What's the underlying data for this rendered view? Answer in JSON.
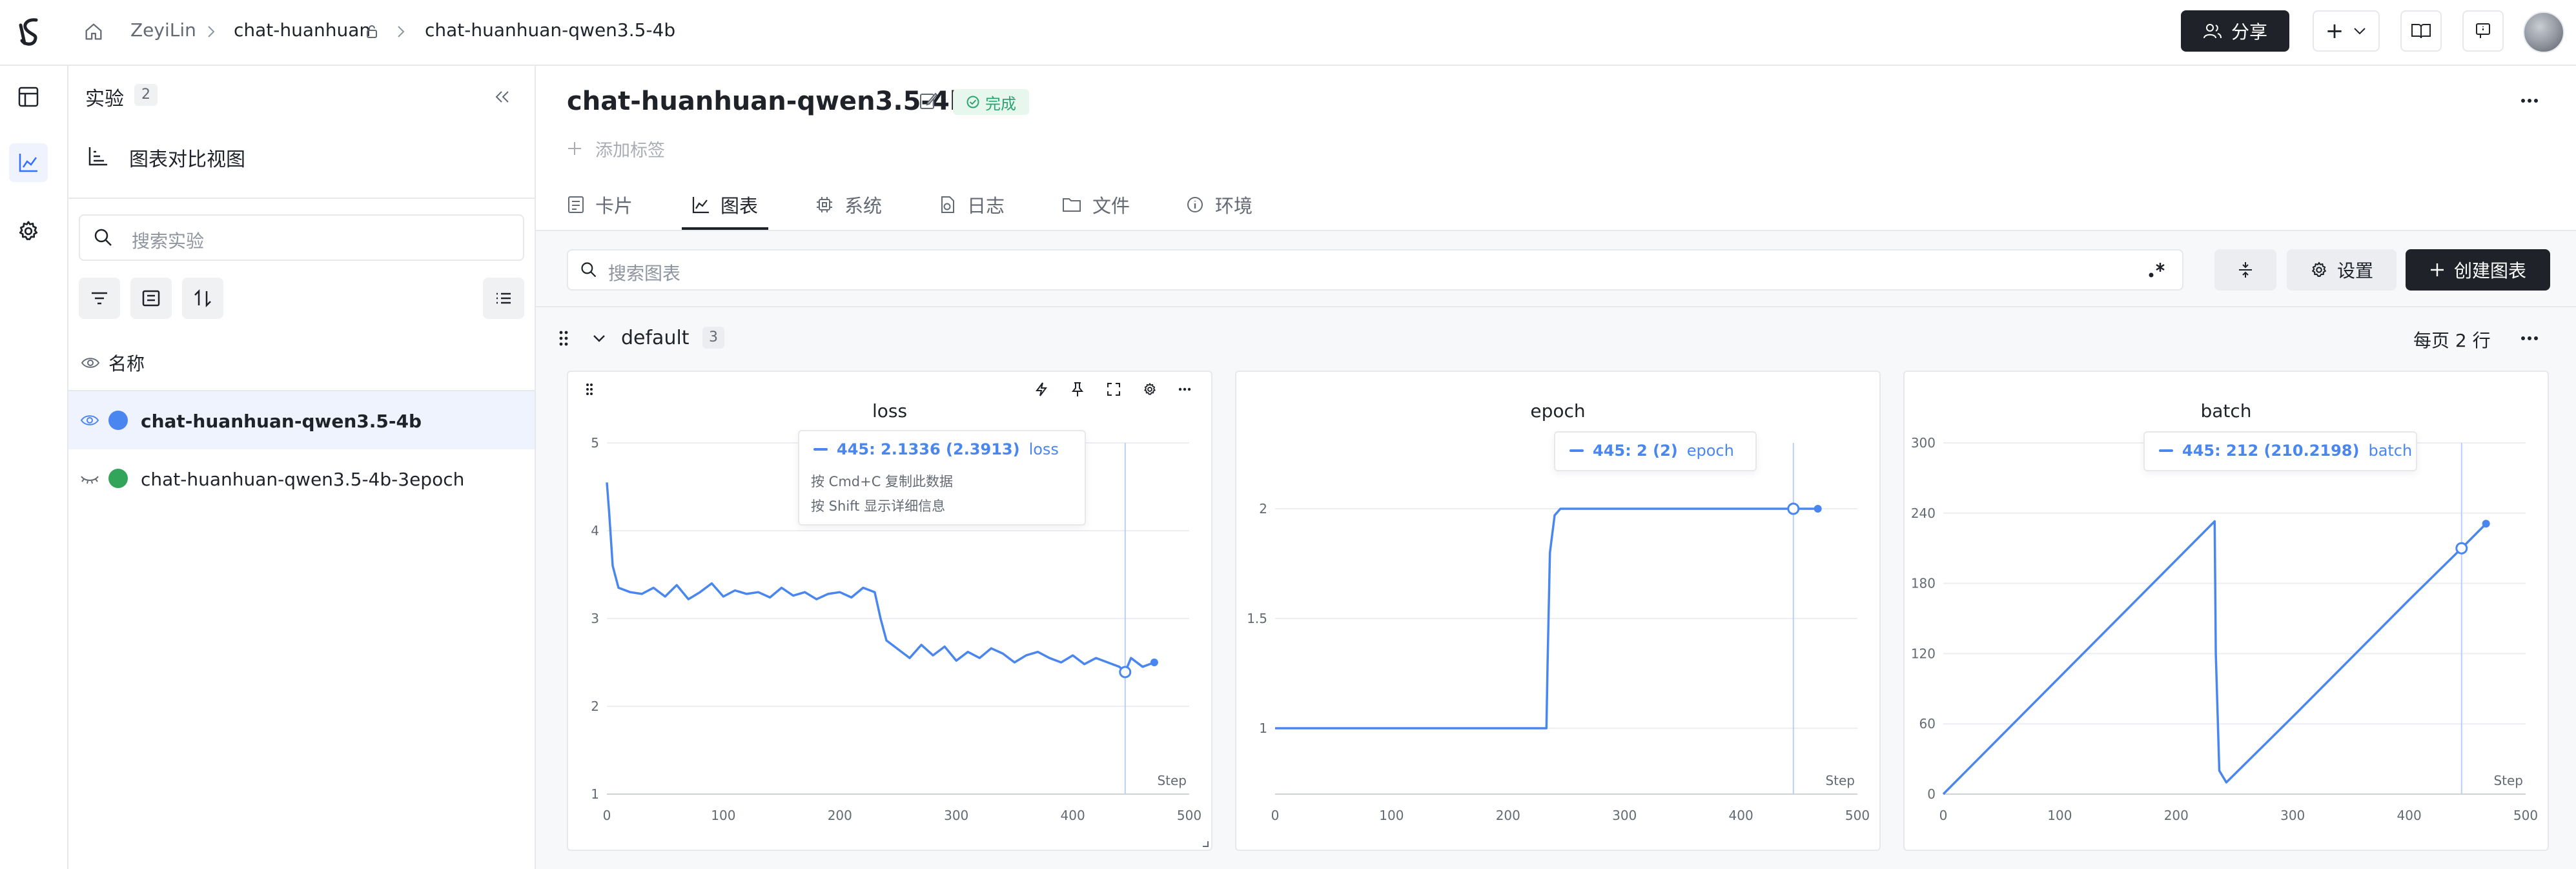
{
  "breadcrumb": {
    "user": "ZeyiLin",
    "project": "chat-huanhuan",
    "run": "chat-huanhuan-qwen3.5-4b"
  },
  "header": {
    "share_label": "分享",
    "add_label": "+"
  },
  "sidebar": {
    "title": "实验",
    "count": "2",
    "view_label": "图表对比视图",
    "search_placeholder": "搜索实验",
    "name_column": "名称",
    "experiments": [
      {
        "name": "chat-huanhuan-qwen3.5-4b",
        "color": "#4a86f0",
        "visible": true,
        "selected": true
      },
      {
        "name": "chat-huanhuan-qwen3.5-4b-3epoch",
        "color": "#33a55b",
        "visible": false,
        "selected": false
      }
    ]
  },
  "run": {
    "title": "chat-huanhuan-qwen3.5-4b",
    "status": "完成",
    "add_tag": "添加标签"
  },
  "tabs": [
    {
      "label": "卡片",
      "icon": "card-icon",
      "active": false
    },
    {
      "label": "图表",
      "icon": "chart-icon",
      "active": true
    },
    {
      "label": "系统",
      "icon": "cpu-icon",
      "active": false
    },
    {
      "label": "日志",
      "icon": "log-icon",
      "active": false
    },
    {
      "label": "文件",
      "icon": "folder-icon",
      "active": false
    },
    {
      "label": "环境",
      "icon": "info-icon",
      "active": false
    }
  ],
  "toolbar": {
    "search_placeholder": "搜索图表",
    "settings_label": "设置",
    "create_label": "创建图表"
  },
  "group": {
    "name": "default",
    "count": "3",
    "per_page": "每页 2 行"
  },
  "colors": {
    "accent": "#4a86f0",
    "status_green": "#2ba471",
    "dark_button": "#1f2329"
  },
  "charts": [
    {
      "tooltip": {
        "value": "445: 2.1336 (2.3913)",
        "metric": "loss",
        "hint1": "按 Cmd+C 复制此数据",
        "hint2": "按 Shift 显示详细信息"
      }
    },
    {
      "tooltip": {
        "value": "445: 2 (2)",
        "metric": "epoch"
      }
    },
    {
      "tooltip": {
        "value": "445: 212 (210.2198)",
        "metric": "batch"
      }
    }
  ],
  "chart_data": [
    {
      "type": "line",
      "title": "loss",
      "xlabel": "Step",
      "ylabel": "",
      "xlim": [
        0,
        500
      ],
      "ylim": [
        1,
        5
      ],
      "xticks": [
        0,
        100,
        200,
        300,
        400,
        500
      ],
      "yticks": [
        1,
        2,
        3,
        4,
        5
      ],
      "hover_x": 445,
      "hover_y": 2.39,
      "series": [
        {
          "color": "#4a86f0",
          "x": [
            0,
            2,
            5,
            10,
            20,
            30,
            40,
            50,
            60,
            70,
            80,
            90,
            100,
            110,
            120,
            130,
            140,
            150,
            160,
            170,
            180,
            190,
            200,
            210,
            220,
            230,
            235,
            240,
            250,
            260,
            270,
            280,
            290,
            300,
            310,
            320,
            330,
            340,
            350,
            360,
            370,
            380,
            390,
            400,
            410,
            420,
            430,
            440,
            445,
            450,
            460,
            470
          ],
          "y": [
            4.55,
            4.2,
            3.6,
            3.35,
            3.3,
            3.28,
            3.35,
            3.25,
            3.38,
            3.22,
            3.3,
            3.4,
            3.25,
            3.32,
            3.28,
            3.3,
            3.24,
            3.35,
            3.26,
            3.3,
            3.22,
            3.28,
            3.3,
            3.24,
            3.35,
            3.3,
            3.0,
            2.75,
            2.65,
            2.55,
            2.7,
            2.58,
            2.68,
            2.52,
            2.62,
            2.55,
            2.66,
            2.6,
            2.5,
            2.58,
            2.62,
            2.55,
            2.5,
            2.58,
            2.48,
            2.55,
            2.5,
            2.45,
            2.39,
            2.55,
            2.45,
            2.5
          ]
        }
      ]
    },
    {
      "type": "line",
      "title": "epoch",
      "xlabel": "Step",
      "ylabel": "",
      "xlim": [
        0,
        500
      ],
      "ylim": [
        0.7,
        2.3
      ],
      "xticks": [
        0,
        100,
        200,
        300,
        400,
        500
      ],
      "yticks": [
        1,
        1.5,
        2
      ],
      "hover_x": 445,
      "hover_y": 2,
      "series": [
        {
          "color": "#4a86f0",
          "x": [
            0,
            100,
            200,
            233,
            234,
            236,
            240,
            245,
            250,
            300,
            400,
            445,
            466
          ],
          "y": [
            1,
            1,
            1,
            1,
            1.3,
            1.8,
            1.97,
            2,
            2,
            2,
            2,
            2,
            2
          ]
        }
      ]
    },
    {
      "type": "line",
      "title": "batch",
      "xlabel": "Step",
      "ylabel": "",
      "xlim": [
        0,
        500
      ],
      "ylim": [
        0,
        300
      ],
      "xticks": [
        0,
        100,
        200,
        300,
        400,
        500
      ],
      "yticks": [
        0,
        60,
        120,
        180,
        240,
        300
      ],
      "hover_x": 445,
      "hover_y": 210,
      "series": [
        {
          "color": "#4a86f0",
          "x": [
            0,
            233,
            234,
            237,
            243,
            300,
            400,
            445,
            466
          ],
          "y": [
            0,
            233,
            120,
            20,
            10,
            66,
            166,
            210,
            231
          ]
        }
      ]
    }
  ]
}
